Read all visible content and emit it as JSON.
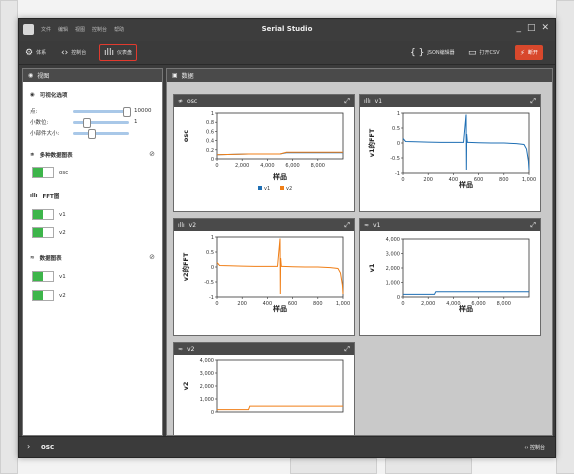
{
  "window": {
    "title": "Serial Studio",
    "menu": [
      "文件",
      "编辑",
      "视图",
      "控制台",
      "帮助"
    ],
    "controls": [
      "_",
      "□",
      "✕"
    ]
  },
  "toolbar": {
    "setup": "体系",
    "console": "控制台",
    "dashboard": "仪表盘",
    "json_editor": "JSON编辑器",
    "open_csv": "打开CSV",
    "connect": "断开"
  },
  "view_panel": {
    "title": "视图",
    "visual_options": {
      "title": "可视化选项",
      "points_label": "点:",
      "points_value": 10000,
      "points_value_text": "10000",
      "points_frac": 1.0,
      "decimals_label": "小数位:",
      "decimals_value": 1,
      "decimals_value_text": "1",
      "decimals_frac": 0.2,
      "widget_size_label": "小部件大小:",
      "widget_size_frac": 0.3
    },
    "multi_plot": {
      "title": "多种数据图表",
      "items": [
        "osc"
      ]
    },
    "fft": {
      "title": "FFT图",
      "items": [
        "v1",
        "v2"
      ]
    },
    "plots": {
      "title": "数据图表",
      "items": [
        "v1",
        "v2"
      ]
    }
  },
  "data_panel": {
    "title": "数据"
  },
  "widgets": {
    "osc": {
      "title": "osc",
      "ylabel": "osc",
      "xlabel": "样品",
      "legend": [
        "v1",
        "v2"
      ]
    },
    "fft_v1": {
      "title": "v1",
      "ylabel": "v1的FFT",
      "xlabel": "样品"
    },
    "fft_v2": {
      "title": "v2",
      "ylabel": "v2的FFT",
      "xlabel": "样品"
    },
    "plot_v1": {
      "title": "v1",
      "ylabel": "v1",
      "xlabel": "样品"
    },
    "plot_v2": {
      "title": "v2",
      "ylabel": "v2",
      "xlabel": ""
    }
  },
  "bottom_bar": {
    "label": "osc",
    "console": "控制台"
  },
  "colors": {
    "v1": "#1f6fb4",
    "v2": "#f07f17",
    "toggle": "#3db54a",
    "accent": "#d8482c",
    "highlight": "#e13a2e"
  },
  "chart_data": [
    {
      "type": "line",
      "title": "osc",
      "xlabel": "样品",
      "ylabel": "osc",
      "xlim": [
        0,
        10000
      ],
      "ylim": [
        -0.1,
        1
      ],
      "xticks": [
        "0",
        "2,000",
        "4,000",
        "6,000",
        "8,000"
      ],
      "yticks": [
        "1",
        "0.8",
        "0.6",
        "0.4",
        "0.2",
        "0"
      ],
      "series": [
        {
          "name": "v1",
          "x": [
            0,
            2500,
            5000,
            5500,
            10000
          ],
          "y": [
            0,
            0.02,
            0.02,
            0.05,
            0.05
          ]
        },
        {
          "name": "v2",
          "x": [
            0,
            2500,
            5000,
            5500,
            10000
          ],
          "y": [
            0,
            0.02,
            0.02,
            0.06,
            0.06
          ]
        }
      ]
    },
    {
      "type": "line",
      "title": "v1",
      "xlabel": "样品",
      "ylabel": "v1的FFT",
      "xlim": [
        0,
        1000
      ],
      "ylim": [
        -1,
        1
      ],
      "xticks": [
        "0",
        "200",
        "400",
        "600",
        "800",
        "1,000"
      ],
      "yticks": [
        "1",
        "0.5",
        "0",
        "-0.5",
        "-1"
      ],
      "series": [
        {
          "x": [
            0,
            20,
            100,
            200,
            300,
            400,
            480,
            500,
            502,
            505,
            510,
            520,
            600,
            700,
            800,
            900,
            960,
            980,
            995,
            1000
          ],
          "y": [
            0.15,
            0.05,
            0.04,
            0.03,
            0.02,
            0.02,
            0.02,
            0.95,
            -0.9,
            0.3,
            0.02,
            0.02,
            0.01,
            0.0,
            0.0,
            -0.02,
            -0.05,
            -0.2,
            -0.6,
            -0.9
          ]
        }
      ]
    },
    {
      "type": "line",
      "title": "v2",
      "xlabel": "样品",
      "ylabel": "v2的FFT",
      "xlim": [
        0,
        1000
      ],
      "ylim": [
        -1,
        1
      ],
      "xticks": [
        "0",
        "200",
        "400",
        "600",
        "800",
        "1,000"
      ],
      "yticks": [
        "1",
        "0.5",
        "0",
        "-0.5",
        "-1"
      ],
      "series": [
        {
          "x": [
            0,
            20,
            100,
            200,
            300,
            400,
            480,
            500,
            502,
            505,
            510,
            520,
            600,
            700,
            800,
            900,
            960,
            980,
            995,
            1000
          ],
          "y": [
            0.15,
            0.05,
            0.04,
            0.03,
            0.02,
            0.02,
            0.02,
            0.95,
            -0.9,
            0.3,
            0.02,
            0.02,
            0.01,
            0.0,
            0.0,
            -0.02,
            -0.05,
            -0.2,
            -0.6,
            -0.9
          ]
        }
      ]
    },
    {
      "type": "line",
      "title": "v1",
      "xlabel": "样品",
      "ylabel": "v1",
      "xlim": [
        0,
        10000
      ],
      "ylim": [
        -200,
        4200
      ],
      "xticks": [
        "0",
        "2,000",
        "4,000",
        "6,000",
        "8,000"
      ],
      "yticks": [
        "4,000",
        "3,000",
        "2,000",
        "1,000",
        "0"
      ],
      "series": [
        {
          "x": [
            0,
            2500,
            2600,
            10000
          ],
          "y": [
            0,
            0,
            200,
            200
          ]
        }
      ]
    },
    {
      "type": "line",
      "title": "v2",
      "xlabel": "",
      "ylabel": "v2",
      "xlim": [
        0,
        10000
      ],
      "ylim": [
        -200,
        4200
      ],
      "xticks": [],
      "yticks": [
        "4,000",
        "3,000",
        "2,000",
        "1,000",
        "0"
      ],
      "series": [
        {
          "x": [
            0,
            2500,
            2600,
            10000
          ],
          "y": [
            0,
            0,
            300,
            300
          ]
        }
      ]
    }
  ]
}
